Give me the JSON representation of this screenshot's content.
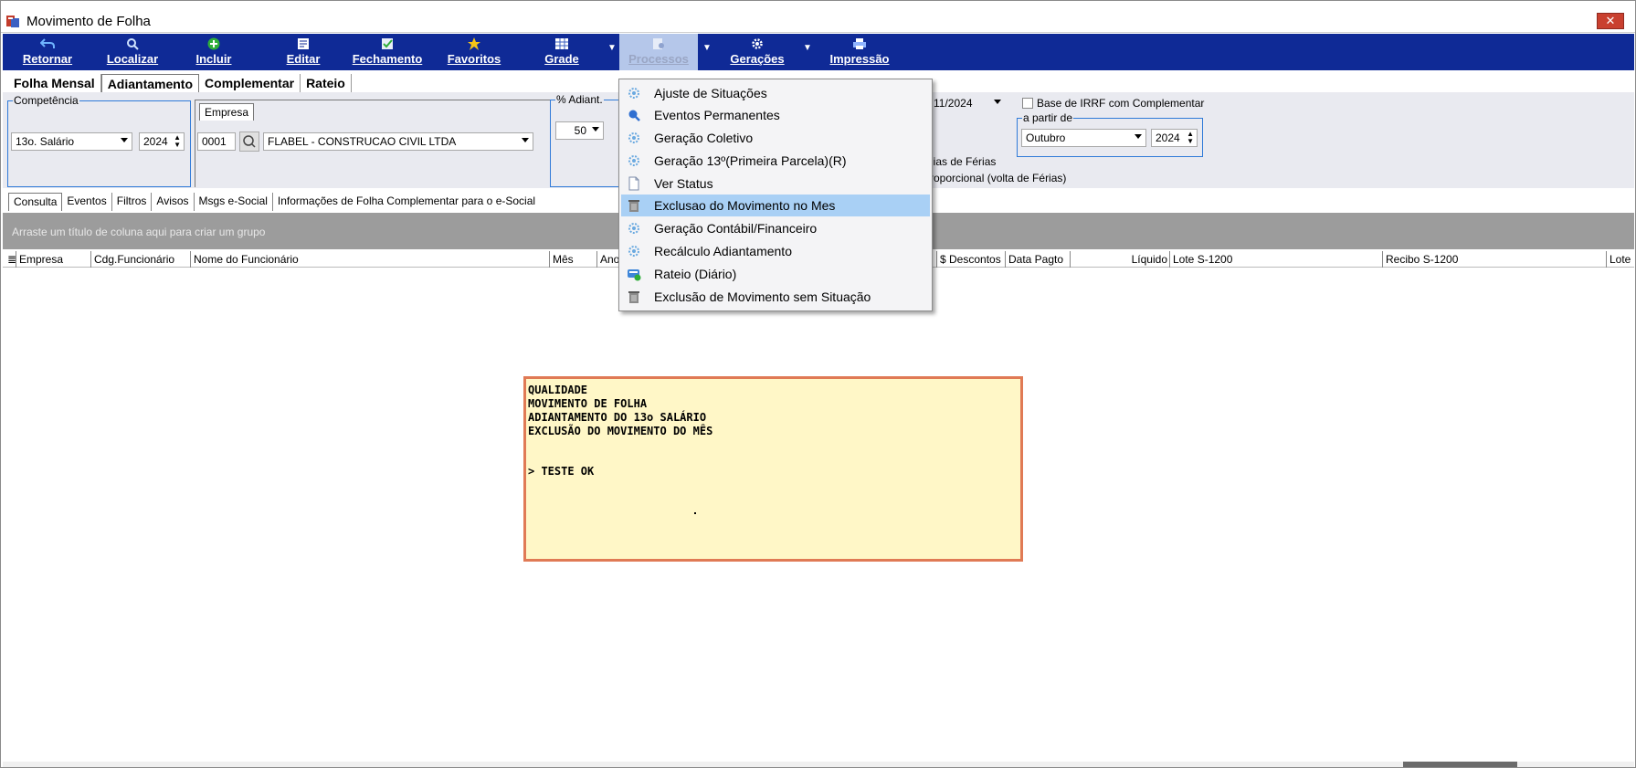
{
  "window": {
    "title": "Movimento de Folha",
    "close_label": "✕"
  },
  "toolbar": {
    "buttons": [
      {
        "label": "Retornar",
        "icon": "back-icon"
      },
      {
        "label": "Localizar",
        "icon": "search-icon"
      },
      {
        "label": "Incluir",
        "icon": "plus-icon"
      },
      {
        "label": "Editar",
        "icon": "edit-icon"
      },
      {
        "label": "Fechamento",
        "icon": "check-doc-icon"
      },
      {
        "label": "Favoritos",
        "icon": "star-icon"
      },
      {
        "label": "Grade",
        "icon": "grid-icon"
      },
      {
        "label": "Processos",
        "icon": "process-icon"
      },
      {
        "label": "Gerações",
        "icon": "gear-icon"
      },
      {
        "label": "Impressão",
        "icon": "printer-icon"
      }
    ]
  },
  "main_tabs": [
    "Folha Mensal",
    "Adiantamento",
    "Complementar",
    "Rateio"
  ],
  "competencia": {
    "label": "Competência",
    "tipo": "13o. Salário",
    "ano": "2024"
  },
  "empresa": {
    "label": "Empresa",
    "codigo": "0001",
    "nome": "FLABEL - CONSTRUCAO CIVIL LTDA"
  },
  "adiant": {
    "label": "% Adiant.",
    "value": "50"
  },
  "date_field": {
    "value": "11/2024"
  },
  "irrf": {
    "checkbox_label": "Base de IRRF com Complementar",
    "partir_label": "a partir de",
    "mes": "Outubro",
    "ano": "2024"
  },
  "ferias": {
    "line1": "dias de Férias",
    "line2": "roporcional (volta de Férias)"
  },
  "sub_tabs": [
    "Consulta",
    "Eventos",
    "Filtros",
    "Avisos",
    "Msgs e-Social",
    "Informações de Folha Complementar para o e-Social"
  ],
  "group_bar_text": "Arraste um título de coluna aqui para criar um grupo",
  "columns": [
    "Empresa",
    "Cdg.Funcionário",
    "Nome do Funcionário",
    "Mês",
    "Ano",
    "$ Descontos",
    "Data Pagto",
    "Líquido",
    "Lote S-1200",
    "Recibo S-1200",
    "Lote"
  ],
  "menu": {
    "items": [
      {
        "label": "Ajuste de Situações",
        "icon": "gear-icon"
      },
      {
        "label": "Eventos Permanentes",
        "icon": "search-icon"
      },
      {
        "label": "Geração Coletivo",
        "icon": "gear-icon"
      },
      {
        "label": "Geração 13º(Primeira Parcela)(R)",
        "icon": "gear-icon"
      },
      {
        "label": "Ver Status",
        "icon": "document-icon"
      },
      {
        "label": "Exclusao do Movimento no Mes",
        "icon": "trash-icon",
        "highlighted": true
      },
      {
        "label": "Geração Contábil/Financeiro",
        "icon": "gear-icon"
      },
      {
        "label": "Recálculo Adiantamento",
        "icon": "gear-icon"
      },
      {
        "label": "Rateio (Diário)",
        "icon": "rateio-icon"
      },
      {
        "label": "Exclusão de Movimento sem Situação",
        "icon": "trash-icon"
      }
    ]
  },
  "note": {
    "lines": [
      "QUALIDADE",
      "MOVIMENTO DE FOLHA",
      "ADIANTAMENTO DO 13o SALÁRIO",
      "EXCLUSÃO DO MOVIMENTO DO MÊS",
      "",
      "",
      "> TESTE OK"
    ]
  },
  "colors": {
    "toolbar": "#0f2a96",
    "menu_highlight": "#a9d0f5",
    "note_bg": "#fff7c7",
    "note_border": "#e07a55",
    "group_border": "#2f7ad8"
  }
}
